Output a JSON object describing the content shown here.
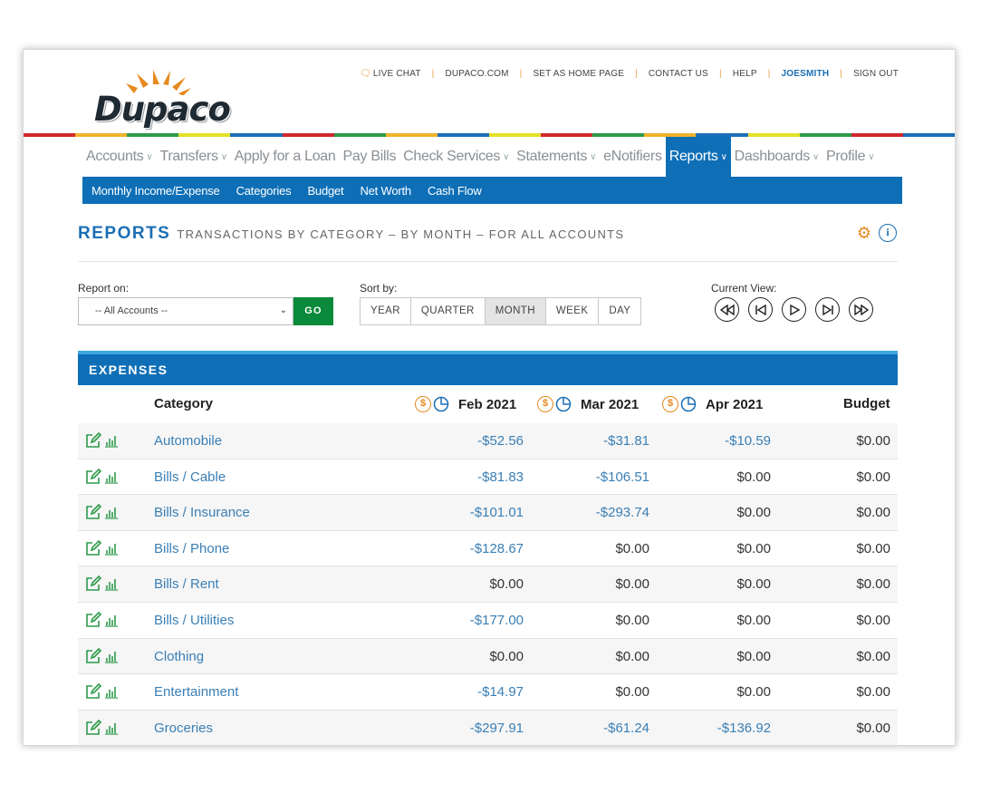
{
  "brand": {
    "name": "Dupaco",
    "colors": {
      "primary": "#0e6fb7",
      "accent": "#e7891f",
      "go": "#0a8a3a"
    }
  },
  "top_links": {
    "live_chat": "LIVE CHAT",
    "dupaco_com": "DUPACO.COM",
    "home_page": "SET AS HOME PAGE",
    "contact": "CONTACT US",
    "help": "HELP",
    "user": "JOESMITH",
    "sign_out": "SIGN OUT"
  },
  "main_nav": [
    {
      "label": "Accounts",
      "chev": true
    },
    {
      "label": "Transfers",
      "chev": true
    },
    {
      "label": "Apply for a Loan",
      "chev": false
    },
    {
      "label": "Pay Bills",
      "chev": false
    },
    {
      "label": "Check Services",
      "chev": true
    },
    {
      "label": "Statements",
      "chev": true
    },
    {
      "label": "eNotifiers",
      "chev": false
    },
    {
      "label": "Reports",
      "chev": true,
      "active": true
    },
    {
      "label": "Dashboards",
      "chev": true
    },
    {
      "label": "Profile",
      "chev": true
    }
  ],
  "sub_nav": [
    "Monthly Income/Expense",
    "Categories",
    "Budget",
    "Net Worth",
    "Cash Flow"
  ],
  "heading": {
    "title": "REPORTS",
    "subtitle": "TRANSACTIONS BY CATEGORY – BY MONTH – FOR ALL ACCOUNTS"
  },
  "filters": {
    "report_on_label": "Report on:",
    "account_value": "-- All Accounts --",
    "go_label": "GO",
    "sort_label": "Sort by:",
    "sort_options": [
      "YEAR",
      "QUARTER",
      "MONTH",
      "WEEK",
      "DAY"
    ],
    "sort_selected": "MONTH",
    "current_view_label": "Current View:"
  },
  "expenses": {
    "title": "EXPENSES",
    "columns": {
      "category": "Category",
      "m1": "Feb 2021",
      "m2": "Mar 2021",
      "m3": "Apr 2021",
      "budget": "Budget"
    },
    "rows": [
      {
        "category": "Automobile",
        "m1": "-$52.56",
        "m2": "-$31.81",
        "m3": "-$10.59",
        "budget": "$0.00"
      },
      {
        "category": "Bills / Cable",
        "m1": "-$81.83",
        "m2": "-$106.51",
        "m3": "$0.00",
        "budget": "$0.00"
      },
      {
        "category": "Bills / Insurance",
        "m1": "-$101.01",
        "m2": "-$293.74",
        "m3": "$0.00",
        "budget": "$0.00"
      },
      {
        "category": "Bills / Phone",
        "m1": "-$128.67",
        "m2": "$0.00",
        "m3": "$0.00",
        "budget": "$0.00"
      },
      {
        "category": "Bills / Rent",
        "m1": "$0.00",
        "m2": "$0.00",
        "m3": "$0.00",
        "budget": "$0.00"
      },
      {
        "category": "Bills / Utilities",
        "m1": "-$177.00",
        "m2": "$0.00",
        "m3": "$0.00",
        "budget": "$0.00"
      },
      {
        "category": "Clothing",
        "m1": "$0.00",
        "m2": "$0.00",
        "m3": "$0.00",
        "budget": "$0.00"
      },
      {
        "category": "Entertainment",
        "m1": "-$14.97",
        "m2": "$0.00",
        "m3": "$0.00",
        "budget": "$0.00"
      },
      {
        "category": "Groceries",
        "m1": "-$297.91",
        "m2": "-$61.24",
        "m3": "-$136.92",
        "budget": "$0.00"
      }
    ]
  }
}
